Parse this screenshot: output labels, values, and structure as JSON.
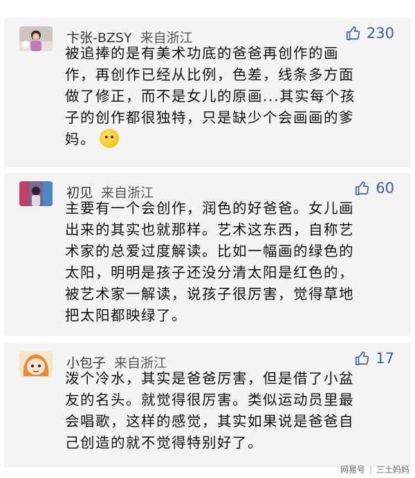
{
  "comments": [
    {
      "user": "卞张-BZSY",
      "location": "来自浙江",
      "likes": "230",
      "avatar_icon": "avatar-child-photo",
      "lines": [
        "被追捧的是有美术功底的爸爸再创作的画",
        "作，再创作已经从比例，色差，线条多方面",
        "做了修正，而不是女儿的原画...其实每个孩",
        "子的创作都很独特，只是缺少个会画画的爹",
        "妈。"
      ],
      "emoji": "thinking-face-emoji"
    },
    {
      "user": "初见",
      "location": "来自浙江",
      "likes": "60",
      "avatar_icon": "avatar-photo",
      "lines": [
        "主要有一个会创作，润色的好爸爸。女儿画",
        "出来的其实也就那样。艺术这东西，自称艺",
        "术家的总爱过度解读。比如一幅画的绿色的",
        "太阳，明明是孩子还没分清太阳是红色的，",
        "被艺术家一解读，说孩子很厉害，觉得草地",
        "把太阳都映绿了。"
      ]
    },
    {
      "user": "小包子",
      "location": "来自浙江",
      "likes": "17",
      "avatar_icon": "avatar-anime-girl",
      "lines": [
        "泼个冷水，其实是爸爸厉害，但是借了小盆",
        "友的名头。就觉得很厉害。类似运动员里最",
        "会唱歌，这样的感觉，其实如果说是爸爸自",
        "己创造的就不觉得特别好了。"
      ]
    }
  ],
  "watermark": {
    "site": "网易号",
    "author": "三土妈妈"
  },
  "colors": {
    "card_bg": "#f4f4f4",
    "like_blue": "#3a5fa0"
  }
}
